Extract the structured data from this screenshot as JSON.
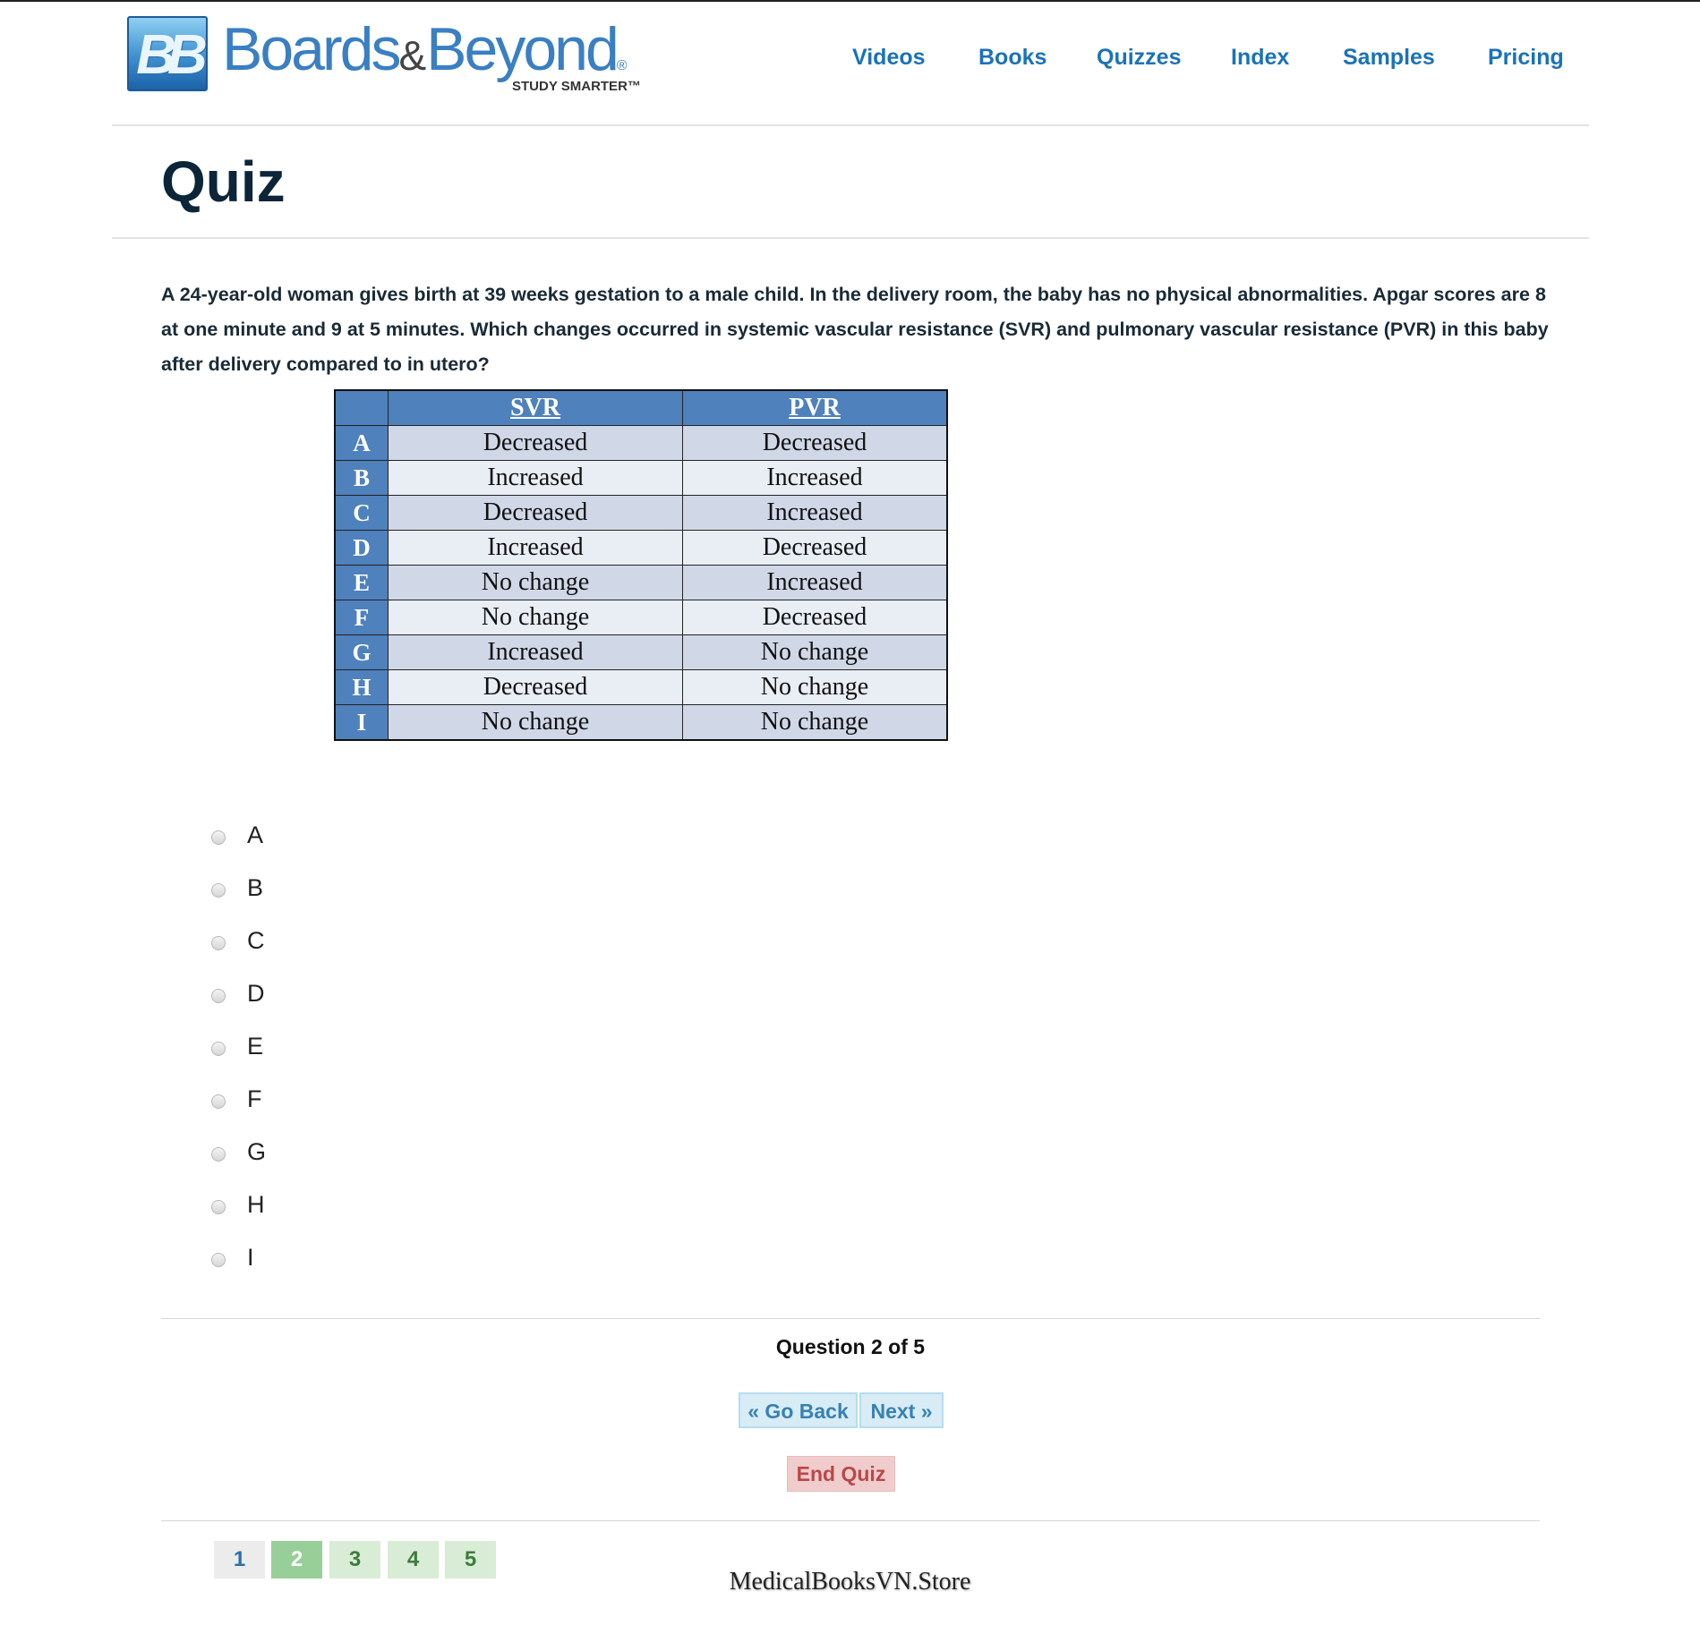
{
  "site": {
    "logo_mark": "BB",
    "brand_part1": "Boards",
    "brand_amp": "&",
    "brand_part2": "Beyond",
    "brand_reg": "®",
    "tagline": "STUDY SMARTER™"
  },
  "nav": {
    "items": [
      "Videos",
      "Books",
      "Quizzes",
      "Index",
      "Samples",
      "Pricing"
    ]
  },
  "page": {
    "title": "Quiz"
  },
  "question": {
    "text": "A 24-year-old woman gives birth at 39 weeks gestation to a male child. In the delivery room, the baby has no physical abnormalities. Apgar scores are 8 at one minute and 9 at 5 minutes. Which changes occurred in systemic vascular resistance (SVR) and pulmonary vascular resistance (PVR) in this baby after delivery compared to in utero?",
    "table": {
      "headers": [
        "",
        "SVR",
        "PVR"
      ],
      "rows": [
        {
          "key": "A",
          "svr": "Decreased",
          "pvr": "Decreased"
        },
        {
          "key": "B",
          "svr": "Increased",
          "pvr": "Increased"
        },
        {
          "key": "C",
          "svr": "Decreased",
          "pvr": "Increased"
        },
        {
          "key": "D",
          "svr": "Increased",
          "pvr": "Decreased"
        },
        {
          "key": "E",
          "svr": "No change",
          "pvr": "Increased"
        },
        {
          "key": "F",
          "svr": "No change",
          "pvr": "Decreased"
        },
        {
          "key": "G",
          "svr": "Increased",
          "pvr": "No change"
        },
        {
          "key": "H",
          "svr": "Decreased",
          "pvr": "No change"
        },
        {
          "key": "I",
          "svr": "No change",
          "pvr": "No change"
        }
      ]
    }
  },
  "answers": {
    "options": [
      "A",
      "B",
      "C",
      "D",
      "E",
      "F",
      "G",
      "H",
      "I"
    ],
    "selected": null
  },
  "navigation": {
    "counter": "Question 2 of 5",
    "back_label": "« Go Back",
    "next_label": "Next »",
    "end_label": "End Quiz"
  },
  "pager": {
    "pages": [
      "1",
      "2",
      "3",
      "4",
      "5"
    ],
    "current": "2"
  },
  "watermark": "MedicalBooksVN.Store",
  "colors": {
    "nav_link": "#1b72b8",
    "title": "#0c2538",
    "table_header": "#4f81bd",
    "table_row_odd": "#d0d8e8",
    "table_row_even": "#e9edf4",
    "button_blue_bg": "#d8ecf6",
    "button_red_bg": "#f0cccc",
    "pager_current": "#98cf98"
  }
}
